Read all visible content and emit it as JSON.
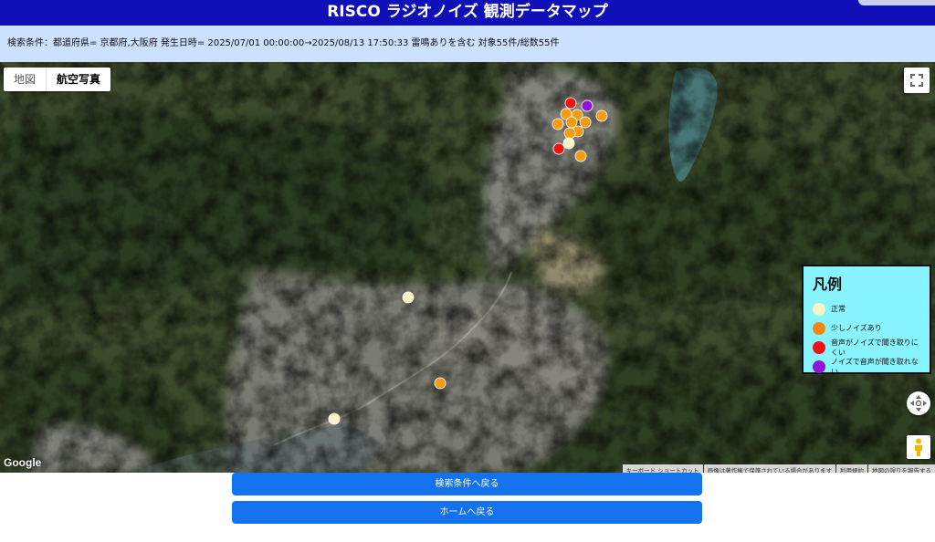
{
  "page": {
    "title": "RISCO ラジオノイズ 観測データマップ",
    "search_conditions": "検索条件：都道府県= 京都府,大阪府 発生日時= 2025/07/01 00:00:00→2025/08/13 17:50:33 雷鳴ありを含む 対象55件/総数55件"
  },
  "map_controls": {
    "map_label": "地図",
    "satellite_label": "航空写真",
    "active": "satellite",
    "fullscreen_icon": "fullscreen-icon",
    "camera_icon": "camera-control-icon",
    "pegman_icon": "pegman-icon"
  },
  "map_attribution": {
    "google": "Google",
    "shortcuts": "キーボード ショートカット",
    "copyright": "画像は著作権で保護されている場合があります",
    "terms": "利用規約",
    "report": "地図の誤りを報告する"
  },
  "legend": {
    "title": "凡例",
    "items": [
      {
        "label": "正常",
        "color": "#f7f3c4"
      },
      {
        "label": "少しノイズあり",
        "color": "#f5860f"
      },
      {
        "label": "音声がノイズで聞き取りにくい",
        "color": "#ee1111"
      },
      {
        "label": "ノイズで音声が聞き取れない",
        "color": "#8e14d6"
      }
    ]
  },
  "markers": [
    {
      "level": 2,
      "color": "#ee1111"
    },
    {
      "level": 3,
      "color": "#8e14d6"
    },
    {
      "level": 1,
      "color": "#f59a12"
    },
    {
      "level": 1,
      "color": "#f59a12"
    },
    {
      "level": 1,
      "color": "#f59a12"
    },
    {
      "level": 1,
      "color": "#f59a12"
    },
    {
      "level": 1,
      "color": "#f59a12"
    },
    {
      "level": 1,
      "color": "#f59a12"
    },
    {
      "level": 1,
      "color": "#f59a12"
    },
    {
      "level": 1,
      "color": "#f59a12"
    },
    {
      "level": 0,
      "color": "#f7f3c4"
    },
    {
      "level": 2,
      "color": "#ee1111"
    },
    {
      "level": 1,
      "color": "#f59a12"
    },
    {
      "level": 0,
      "color": "#f7f3c4"
    },
    {
      "level": 1,
      "color": "#f59a12"
    },
    {
      "level": 0,
      "color": "#f7f3c4"
    }
  ],
  "buttons": {
    "back_to_search": "検索条件へ戻る",
    "back_to_home": "ホームへ戻る"
  }
}
